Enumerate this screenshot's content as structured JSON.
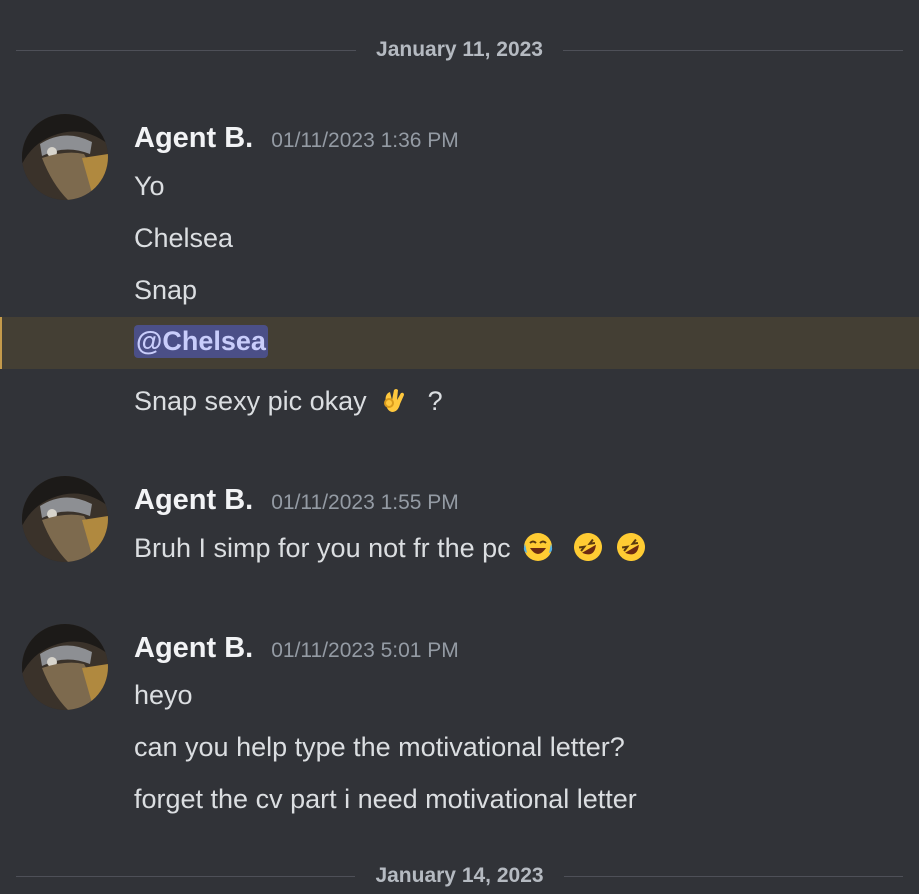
{
  "dividers": {
    "first": "January 11, 2023",
    "second": "January 14, 2023"
  },
  "messages": [
    {
      "username": "Agent B.",
      "timestamp": "01/11/2023 1:36 PM",
      "lines": [
        "Yo",
        "Chelsea",
        "Snap"
      ],
      "mention": "@Chelsea",
      "last_line": "Snap sexy pic okay",
      "last_line_suffix": "?"
    },
    {
      "username": "Agent B.",
      "timestamp": "01/11/2023 1:55 PM",
      "lines": [
        "Bruh I simp for you not fr the pc"
      ]
    },
    {
      "username": "Agent B.",
      "timestamp": "01/11/2023 5:01 PM",
      "lines": [
        "heyo",
        "can you help type the motivational letter?",
        "forget the cv part i need motivational letter"
      ]
    }
  ],
  "icons": {
    "ok_hand": "ok-hand-emoji",
    "tears_of_joy": "face-with-tears-of-joy-emoji",
    "rofl": "rolling-on-the-floor-laughing-emoji"
  },
  "colors": {
    "background": "#313338",
    "mention_highlight": "#443f34",
    "mention_pill": "#4b4f87"
  }
}
